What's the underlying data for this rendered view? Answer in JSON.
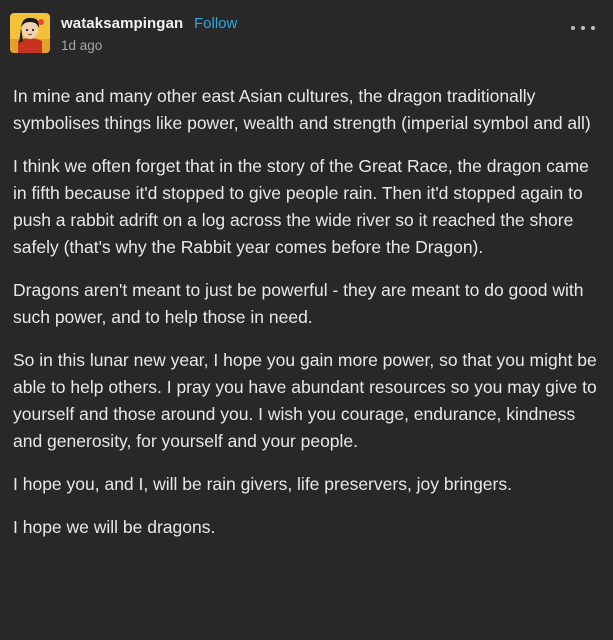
{
  "post": {
    "author": {
      "username": "wataksampingan",
      "follow_label": "Follow",
      "avatar_icon": "cartoon-character-avatar"
    },
    "timestamp": "1d ago",
    "more_icon": "more-options-icon",
    "paragraphs": [
      "In mine and many other east Asian cultures, the dragon traditionally symbolises things like power, wealth and strength (imperial symbol and all)",
      "I think we often forget that in the story of the Great Race, the dragon came in fifth because it'd stopped to give people rain. Then it'd stopped again to push a rabbit adrift on a log across the wide river so it reached the shore safely (that's why the Rabbit year comes before the Dragon).",
      "Dragons aren't meant to just be powerful - they are meant to do good with such power, and to help those in need.",
      "So in this lunar new year, I hope you gain more power, so that you might be able to help others. I pray you have abundant resources so you may give to yourself and those around you. I wish you courage, endurance, kindness and generosity, for yourself and your people.",
      "I hope you, and I, will be rain givers, life preservers, joy bringers.",
      "I hope we will be dragons."
    ]
  },
  "colors": {
    "background": "#282828",
    "text": "#e8e8e8",
    "follow": "#2ea7e8",
    "muted": "#a5a5a5"
  }
}
